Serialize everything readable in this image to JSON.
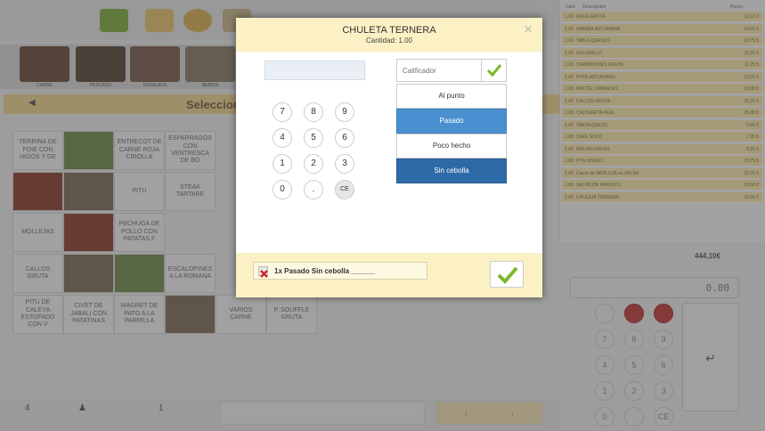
{
  "background": {
    "selection_title": "Seleccion",
    "category_labels": [
      "CARNE",
      "PESCADO",
      "ENSALADA",
      "BEBIDA"
    ],
    "tiles": [
      {
        "label": "TERRINA DE FOIE CON HIGOS Y GE",
        "photo": false
      },
      {
        "label": "",
        "photo": true
      },
      {
        "label": "ENTRECOT DE CARNE ROJA CRIOLLA",
        "photo": false
      },
      {
        "label": "ESPARRAGOS CON VENTRESCA DE BO",
        "photo": false
      },
      {
        "label": "",
        "photo": true
      },
      {
        "label": "",
        "photo": true
      },
      {
        "label": "PITU",
        "photo": false
      },
      {
        "label": "STEAK TARTARE",
        "photo": false
      },
      {
        "label": "MOLLEJAS",
        "photo": false
      },
      {
        "label": "",
        "photo": true
      },
      {
        "label": "PECHUGA DE POLLO CON PATATAS F",
        "photo": false
      },
      {
        "label": "CALLOS GRUTA",
        "photo": false
      },
      {
        "label": "",
        "photo": true
      },
      {
        "label": "",
        "photo": true
      },
      {
        "label": "ESCALOPINES A LA ROMANA",
        "photo": false
      },
      {
        "label": "PITU DE CALEYA ESTOFADO CON V",
        "photo": false
      },
      {
        "label": "CIVET DE JABALI CON PATATINAS",
        "photo": false
      },
      {
        "label": "MAGRET DE PATO A LA PARRILLA",
        "photo": false
      },
      {
        "label": "",
        "photo": true
      },
      {
        "label": "VARIOS CARNE",
        "photo": false
      },
      {
        "label": "P. SOUFFLE GRUTA",
        "photo": false
      }
    ],
    "order_header": {
      "qty": "Cant.",
      "desc": "Descripción",
      "price": "Precio"
    },
    "order_rows": [
      {
        "q": "1.00",
        "n": "AGUA GRUTA",
        "p": "12.10 €"
      },
      {
        "q": "1.00",
        "n": "FABADA ASTURIANA",
        "p": "14.00 €"
      },
      {
        "q": "1.00",
        "n": "TABLA QUESOS",
        "p": "18.75 €"
      },
      {
        "q": "1.00",
        "n": "SOLOMILLO",
        "p": "15.25 €"
      },
      {
        "q": "1.00",
        "n": "CARBAYONES GRUTA",
        "p": "11.25 €"
      },
      {
        "q": "1.00",
        "n": "POTE ASTURIANO",
        "p": "13.50 €"
      },
      {
        "q": "1.00",
        "n": "PASTEL CABRALES",
        "p": "15.00 €"
      },
      {
        "q": "1.00",
        "n": "CALLOS GRUTA",
        "p": "15.25 €"
      },
      {
        "q": "1.00",
        "n": "CALDERETA REAL",
        "p": "25.00 €"
      },
      {
        "q": "1.00",
        "n": "TARTA QUESO",
        "p": "9.80 €"
      },
      {
        "q": "1.00",
        "n": "CAFE SOLO",
        "p": "2.25 €"
      },
      {
        "q": "1.00",
        "n": "PASTAS FRITAS",
        "p": "8.25 €"
      },
      {
        "q": "1.00",
        "n": "PITU ASADO",
        "p": "23.75 €"
      },
      {
        "q": "1.00",
        "n": "Carne de MERLUZA en SALSA",
        "p": "22.75 €"
      },
      {
        "q": "1.00",
        "n": "SALPICON MARISCO",
        "p": "15.50 €"
      },
      {
        "q": "1.00",
        "n": "CHULETA TERNERA",
        "p": "16.50 €"
      }
    ],
    "total": "444,10€",
    "display_value": "0.00",
    "keypad": [
      "7",
      "8",
      "9",
      "4",
      "5",
      "6",
      "1",
      "2",
      "3",
      "0",
      ".",
      "CE"
    ],
    "enter_symbol": "↵",
    "table_count": "4",
    "covers": "1",
    "arrow_up": "↑",
    "arrow_down": "↓"
  },
  "modal": {
    "title": "CHULETA TERNERA",
    "subtitle": "Cantidad: 1.00",
    "close_symbol": "×",
    "keys": [
      "7",
      "8",
      "9",
      "4",
      "5",
      "6",
      "1",
      "2",
      "3",
      "0",
      ".",
      "CE"
    ],
    "calificador_placeholder": "Calificador",
    "options": [
      {
        "label": "Al punto",
        "selected": false
      },
      {
        "label": "Pasado",
        "selected": true
      },
      {
        "label": "Poco hecho",
        "selected": false
      },
      {
        "label": "Sin cebolla",
        "selected": true
      }
    ],
    "summary_line": "1x Pasado  Sin cebolla ______",
    "colors": {
      "accent_blue": "#4a90d0",
      "dark_blue": "#2f6aa8",
      "header_yellow": "#fbf1c4",
      "check_green": "#7ab928"
    }
  }
}
